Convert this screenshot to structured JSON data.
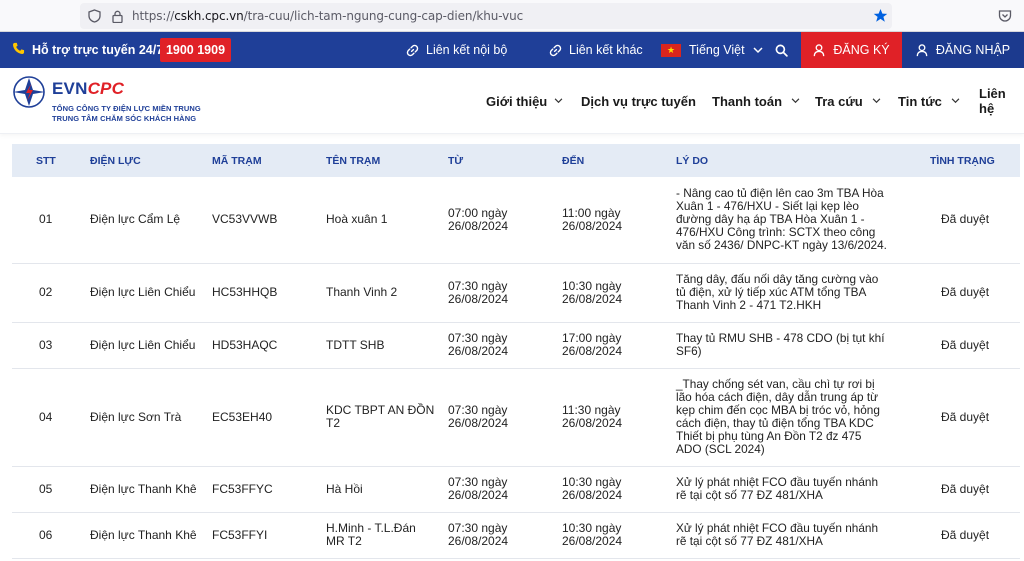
{
  "browser": {
    "url_prefix": "https://",
    "url_host": "cskh.cpc.vn",
    "url_path": "/tra-cuu/lich-tam-ngung-cung-cap-dien/khu-vuc"
  },
  "topbar": {
    "support_label": "Hỗ trợ trực tuyến 24/7:",
    "hotline": "1900 1909",
    "internal_link": "Liên kết nội bộ",
    "other_link": "Liên kết khác",
    "language": "Tiếng Việt",
    "register": "ĐĂNG KÝ",
    "login": "ĐĂNG NHẬP"
  },
  "header": {
    "brand_evn": "EVN",
    "brand_cpc": "CPC",
    "subtitle1": "TỔNG CÔNG TY ĐIỆN LỰC MIỀN TRUNG",
    "subtitle2": "TRUNG TÂM CHĂM SÓC KHÁCH HÀNG",
    "nav": [
      {
        "label": "Giới thiệu"
      },
      {
        "label": "Dịch vụ trực tuyến"
      },
      {
        "label": "Thanh toán"
      },
      {
        "label": "Tra cứu"
      },
      {
        "label": "Tin tức"
      },
      {
        "label": "Liên hệ"
      }
    ]
  },
  "table": {
    "headers": {
      "stt": "STT",
      "dien_luc": "ĐIỆN LỰC",
      "ma_tram": "MÃ TRẠM",
      "ten_tram": "TÊN TRẠM",
      "tu": "TỪ",
      "den": "ĐẾN",
      "ly_do": "LÝ DO",
      "tinh_trang": "TÌNH TRẠNG"
    },
    "rows": [
      {
        "stt": "01",
        "dien_luc": "Điện lực Cẩm Lệ",
        "ma_tram": "VC53VVWB",
        "ten_tram": "Hoà xuân 1",
        "tu": "07:00 ngày 26/08/2024",
        "den": "11:00 ngày 26/08/2024",
        "ly_do": "- Nâng cao tủ điện lên cao 3m TBA Hòa Xuân 1 - 476/HXU - Siết lại kẹp lèo đường dây hạ áp TBA Hòa Xuân 1 - 476/HXU Công trình: SCTX theo công văn số 2436/ DNPC-KT ngày 13/6/2024.",
        "tinh_trang": "Đã duyệt"
      },
      {
        "stt": "02",
        "dien_luc": "Điện lực Liên Chiểu",
        "ma_tram": "HC53HHQB",
        "ten_tram": "Thanh Vinh 2",
        "tu": "07:30 ngày 26/08/2024",
        "den": "10:30 ngày 26/08/2024",
        "ly_do": "Tăng dây, đấu nối dây tăng cường vào tủ điện, xử lý tiếp xúc ATM tổng TBA Thanh Vinh 2 - 471 T2.HKH",
        "tinh_trang": "Đã duyệt"
      },
      {
        "stt": "03",
        "dien_luc": "Điện lực Liên Chiểu",
        "ma_tram": "HD53HAQC",
        "ten_tram": "TDTT SHB",
        "tu": "07:30 ngày 26/08/2024",
        "den": "17:00 ngày 26/08/2024",
        "ly_do": "Thay tủ RMU SHB - 478 CDO (bị tụt khí SF6)",
        "tinh_trang": "Đã duyệt"
      },
      {
        "stt": "04",
        "dien_luc": "Điện lực Sơn Trà",
        "ma_tram": "EC53EH40",
        "ten_tram": "KDC TBPT AN ĐỒN T2",
        "tu": "07:30 ngày 26/08/2024",
        "den": "11:30 ngày 26/08/2024",
        "ly_do": "_Thay chống sét van, cầu chì tự rơi bị lão hóa cách điện, dây dẫn trung áp từ kẹp chim đến cọc MBA bị tróc vỏ, hỏng cách điện, thay tủ điện tổng TBA KDC Thiết bị phụ tùng An Đồn T2 đz 475 ADO (SCL 2024)",
        "tinh_trang": "Đã duyệt"
      },
      {
        "stt": "05",
        "dien_luc": "Điện lực Thanh Khê",
        "ma_tram": "FC53FFYC",
        "ten_tram": "Hà Hồi",
        "tu": "07:30 ngày 26/08/2024",
        "den": "10:30 ngày 26/08/2024",
        "ly_do": "Xử lý phát nhiệt FCO đầu tuyến nhánh rẽ tại cột số 77 ĐZ 481/XHA",
        "tinh_trang": "Đã duyệt"
      },
      {
        "stt": "06",
        "dien_luc": "Điện lực Thanh Khê",
        "ma_tram": "FC53FFYI",
        "ten_tram": "H.Minh - T.L.Đán MR T2",
        "tu": "07:30 ngày 26/08/2024",
        "den": "10:30 ngày 26/08/2024",
        "ly_do": "Xử lý phát nhiệt FCO đầu tuyến nhánh rẽ tại cột số 77 ĐZ 481/XHA",
        "tinh_trang": "Đã duyệt"
      }
    ]
  }
}
